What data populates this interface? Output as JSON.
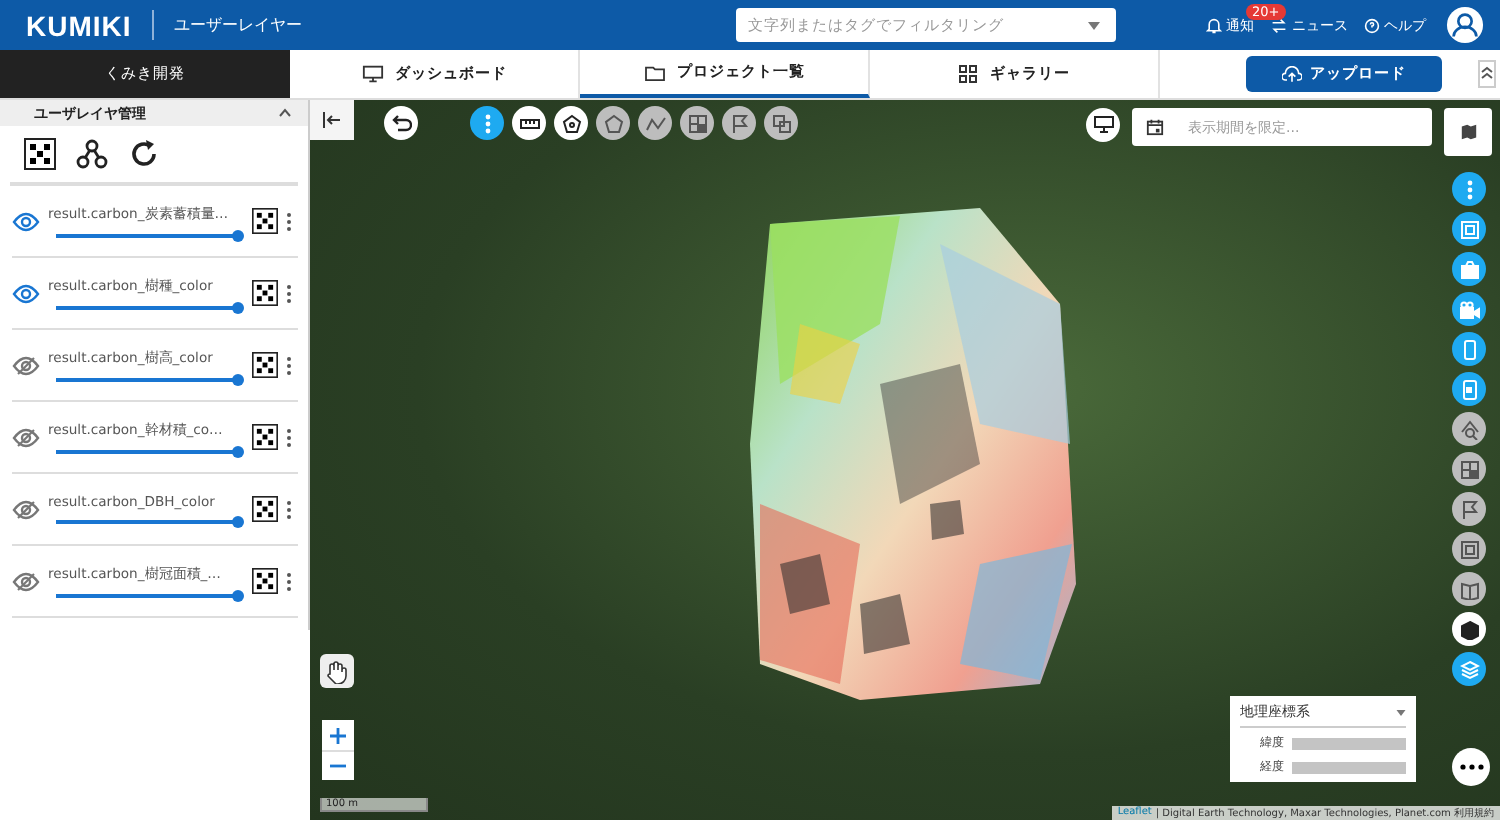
{
  "header": {
    "logo": "KUMIKI",
    "subtitle": "ユーザーレイヤー",
    "search_placeholder": "文字列またはタグでフィルタリング",
    "notifications": "通知",
    "notification_badge": "20+",
    "news": "ニュース",
    "help": "ヘルプ"
  },
  "nav": {
    "organization": "くみき開発",
    "tabs": [
      {
        "label": "ダッシュボード",
        "selected": false
      },
      {
        "label": "プロジェクト一覧",
        "selected": true
      },
      {
        "label": "ギャラリー",
        "selected": false
      }
    ],
    "upload": "アップロード"
  },
  "panel": {
    "title": "ユーザレイヤ管理",
    "layers": [
      {
        "name": "result.carbon_炭素蓄積量…",
        "visible": true,
        "level": 1
      },
      {
        "name": "result.carbon_樹種_color",
        "visible": true,
        "level": 1
      },
      {
        "name": "result.carbon_樹高_color",
        "visible": false,
        "level": 1
      },
      {
        "name": "result.carbon_幹材積_co…",
        "visible": false,
        "level": 1
      },
      {
        "name": "result.carbon_DBH_color",
        "visible": false,
        "level": 1
      },
      {
        "name": "result.carbon_樹冠面積_…",
        "visible": false,
        "level": 1
      }
    ]
  },
  "map": {
    "toolbar": [
      {
        "kind": "blue"
      },
      {
        "kind": "white"
      },
      {
        "kind": "white"
      },
      {
        "kind": "grey"
      },
      {
        "kind": "grey"
      },
      {
        "kind": "grey"
      },
      {
        "kind": "grey"
      },
      {
        "kind": "grey"
      }
    ],
    "date_placeholder": "表示期間を限定...",
    "rail": [
      {
        "kind": "blue"
      },
      {
        "kind": "blue"
      },
      {
        "kind": "blue"
      },
      {
        "kind": "blue"
      },
      {
        "kind": "blue"
      },
      {
        "kind": "blue"
      },
      {
        "kind": "grey"
      },
      {
        "kind": "grey"
      },
      {
        "kind": "grey"
      },
      {
        "kind": "grey"
      },
      {
        "kind": "grey"
      },
      {
        "kind": "white"
      },
      {
        "kind": "blue"
      }
    ],
    "coordinates": {
      "system": "地理座標系",
      "latitude_label": "緯度",
      "longitude_label": "経度"
    },
    "scale": "100 m",
    "attribution_link": "Leaflet",
    "attribution": "| Digital Earth Technology, Maxar Technologies, Planet.com 利用規約"
  }
}
